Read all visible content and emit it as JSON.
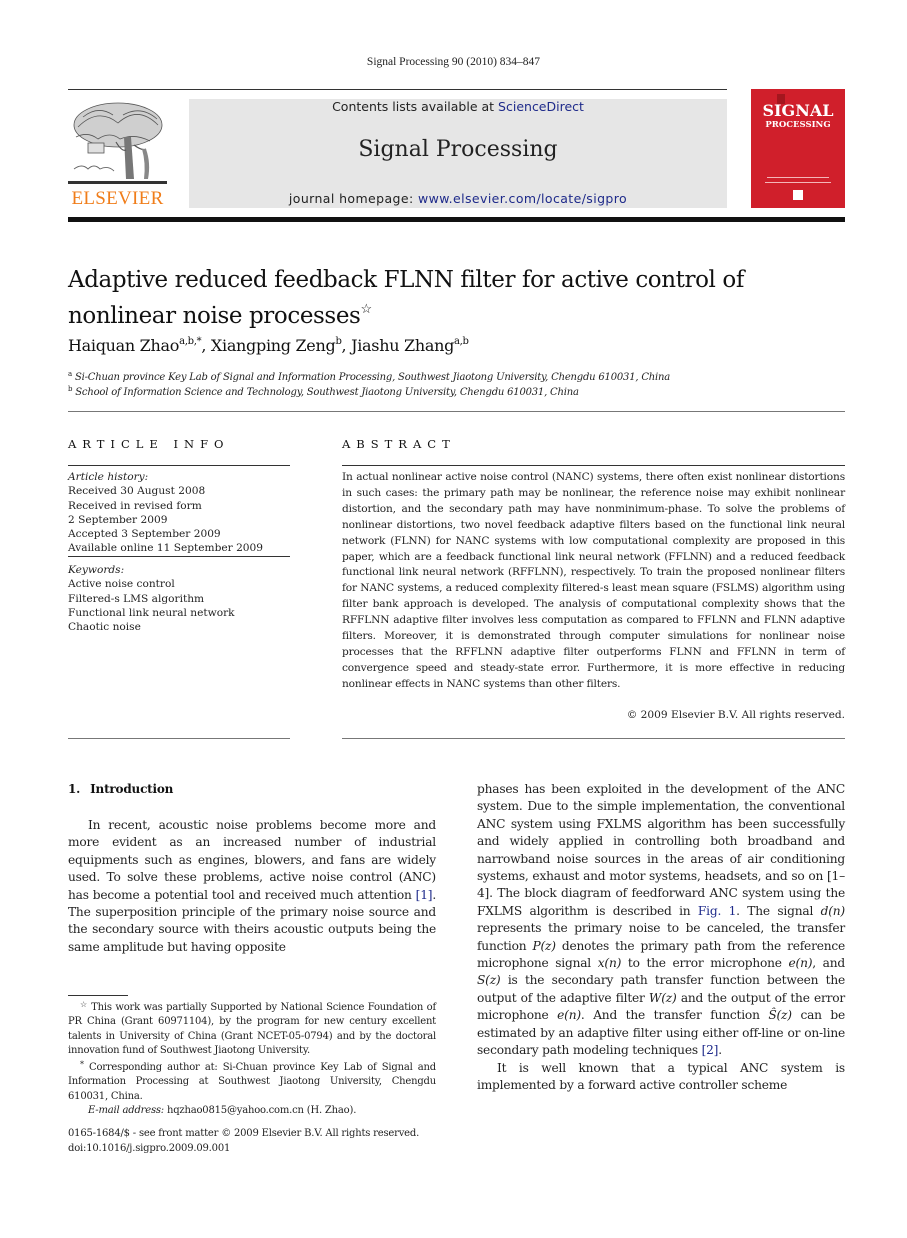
{
  "running_head": "Signal Processing 90 (2010) 834–847",
  "masthead": {
    "publisher_logo_text": "ELSEVIER",
    "contents_prefix": "Contents lists available at ",
    "contents_link": "ScienceDirect",
    "journal_name": "Signal Processing",
    "homepage_prefix": "journal homepage: ",
    "homepage_link": "www.elsevier.com/locate/sigpro",
    "cover": {
      "line1": "SIGNAL",
      "line2": "PROCESSING",
      "color": "#d01f2b"
    },
    "logo_color": "#f07d1a",
    "link_color": "#1e2a8a"
  },
  "article": {
    "title": "Adaptive reduced feedback FLNN filter for active control of nonlinear noise processes",
    "title_note_mark": "☆",
    "authors": [
      {
        "name": "Haiquan Zhao",
        "affil": "a,b,*"
      },
      {
        "name": "Xiangping Zeng",
        "affil": "b"
      },
      {
        "name": "Jiashu Zhang",
        "affil": "a,b"
      }
    ],
    "author_separator": ", ",
    "affiliations": [
      {
        "mark": "a",
        "text": "Si-Chuan province Key Lab of Signal and Information Processing, Southwest Jiaotong University, Chengdu 610031, China"
      },
      {
        "mark": "b",
        "text": "School of Information Science and Technology, Southwest Jiaotong University, Chengdu 610031, China"
      }
    ]
  },
  "article_info": {
    "heading": "ARTICLE INFO",
    "history_label": "Article history:",
    "history": [
      "Received 30 August 2008",
      "Received in revised form",
      "2 September 2009",
      "Accepted 3 September 2009",
      "Available online 11 September 2009"
    ],
    "keywords_label": "Keywords:",
    "keywords": [
      "Active noise control",
      "Filtered-s LMS algorithm",
      "Functional link neural network",
      "Chaotic noise"
    ]
  },
  "abstract": {
    "heading": "ABSTRACT",
    "text": "In actual nonlinear active noise control (NANC) systems, there often exist nonlinear distortions in such cases: the primary path may be nonlinear, the reference noise may exhibit nonlinear distortion, and the secondary path may have nonminimum-phase. To solve the problems of nonlinear distortions, two novel feedback adaptive filters based on the functional link neural network (FLNN) for NANC systems with low computational complexity are proposed in this paper, which are a feedback functional link neural network (FFLNN) and a reduced feedback functional link neural network (RFFLNN), respectively. To train the proposed nonlinear filters for NANC systems, a reduced complexity filtered-s least mean square (FSLMS) algorithm using filter bank approach is developed. The analysis of computational complexity shows that the RFFLNN adaptive filter involves less computation as compared to FFLNN and FLNN adaptive filters. Moreover, it is demonstrated through computer simulations for nonlinear noise processes that the RFFLNN adaptive filter outperforms FLNN and FFLNN in term of convergence speed and steady-state error. Furthermore, it is more effective in reducing nonlinear effects in NANC systems than other filters.",
    "copyright": "© 2009 Elsevier B.V. All rights reserved."
  },
  "section1": {
    "number": "1.",
    "title": "Introduction",
    "left_col": {
      "p1_a": "In recent, acoustic noise problems become more and more evident as an increased number of industrial equipments such as engines, blowers, and fans are widely used. To solve these problems, active noise control (ANC) has become a potential tool and received much attention ",
      "ref1": "[1]",
      "p1_b": ". The superposition principle of the primary noise source and the secondary source with theirs acoustic outputs being the same amplitude but having opposite"
    },
    "right_col": {
      "p1_a": "phases has been exploited in the development of the ANC system. Due to the simple implementation, the conventional ANC system using FXLMS algorithm has been successfully and widely applied in controlling both broadband and narrowband noise sources in the areas of air conditioning systems, exhaust and motor systems, headsets, and so on [1–4]. The block diagram of feedforward ANC system using the FXLMS algorithm is described in ",
      "fig_ref": "Fig. 1",
      "p1_b": ". The signal ",
      "d_n": "d(n)",
      "p1_c": " represents the primary noise to be canceled, the transfer function ",
      "P_z": "P(z)",
      "p1_d": " denotes the primary path from the reference microphone signal ",
      "x_n": "x(n)",
      "p1_e": " to the error microphone ",
      "e_n": "e(n)",
      "p1_f": ", and ",
      "S_z": "S(z)",
      "p1_g": " is the secondary path transfer function between the output of the adaptive filter ",
      "W_z": "W(z)",
      "p1_h": " and the output of the error microphone ",
      "e_n2": "e(n)",
      "p1_i": ". And the transfer function ",
      "Shat_z": "Ŝ(z)",
      "p1_j": " can be estimated by an adaptive filter using either off-line or on-line secondary path modeling techniques ",
      "ref2": "[2]",
      "p1_k": ".",
      "p2": "It is well known that a typical ANC system is implemented by a forward active controller scheme"
    }
  },
  "footnotes": {
    "star_mark": "☆",
    "star_text": "This work was partially Supported by National Science Foundation of PR China (Grant 60971104), by the program for new century excellent talents in University of China (Grant NCET-05-0794) and by the doctoral innovation fund of Southwest Jiaotong University.",
    "corr_mark": "*",
    "corr_text": "Corresponding author at: Si-Chuan province Key Lab of Signal and Information Processing at Southwest Jiaotong University, Chengdu 610031, China.",
    "email_label": "E-mail address:",
    "email_value": "hqzhao0815@yahoo.com.cn (H. Zhao)."
  },
  "issn_line": "0165-1684/$ - see front matter © 2009 Elsevier B.V. All rights reserved.",
  "doi_line": "doi:10.1016/j.sigpro.2009.09.001"
}
